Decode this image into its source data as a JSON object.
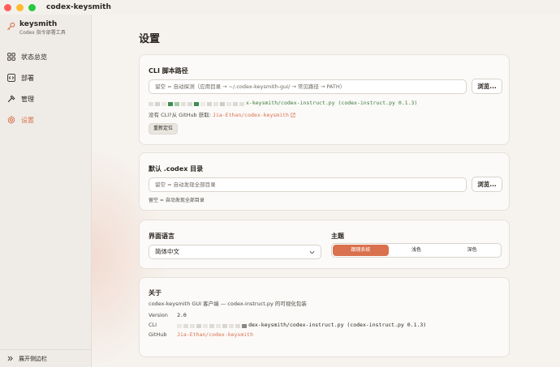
{
  "window": {
    "title": "codex-keysmith"
  },
  "brand": {
    "name": "keysmith",
    "subtitle": "Codex 指令部署工具"
  },
  "nav": [
    {
      "label": "状态总览",
      "icon": "grid-icon"
    },
    {
      "label": "部署",
      "icon": "code-icon"
    },
    {
      "label": "管理",
      "icon": "hammer-icon"
    },
    {
      "label": "设置",
      "icon": "gear-icon",
      "active": true
    }
  ],
  "sidebar_footer": {
    "label": "展开侧边栏"
  },
  "page": {
    "title": "设置"
  },
  "cli_card": {
    "title": "CLI 脚本路径",
    "placeholder": "留空 = 自动探测（应用目录 → ~/.codex-keysmith-gui/ → 常见路径 → PATH）",
    "browse": "浏览...",
    "detected": "x-keysmith/codex-instruct.py (codex-instruct.py 0.1.3)",
    "no_cli_prefix": "没有 CLI?从 GitHub 获取:",
    "github_link": "Jia-Ethan/codex-keysmith",
    "relocate": "重新定位"
  },
  "codex_card": {
    "title": "默认 .codex 目录",
    "placeholder": "留空 = 自动发现全部目录",
    "browse": "浏览...",
    "hint": "留空 = 自动发现全部目录"
  },
  "prefs_card": {
    "language_label": "界面语言",
    "language_value": "简体中文",
    "theme_label": "主题",
    "theme_options": [
      "跟随系统",
      "浅色",
      "深色"
    ],
    "theme_selected": 0
  },
  "about_card": {
    "title": "关于",
    "desc": "codex-keysmith GUI 客户端 — codex-instruct.py 的可视化包装",
    "version_key": "Version",
    "version_value": "2.0",
    "cli_key": "CLI",
    "cli_value": "dex-keysmith/codex-instruct.py (codex-instruct.py 0.1.3)",
    "github_key": "GitHub",
    "github_value": "Jia-Ethan/codex-keysmith"
  },
  "colors": {
    "accent": "#d9704e",
    "success_text": "#3a7a3a"
  }
}
